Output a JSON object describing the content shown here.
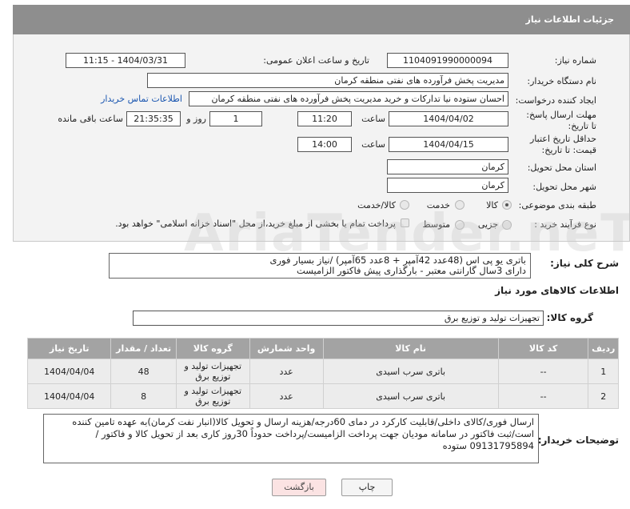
{
  "header": {
    "title": "جزئیات اطلاعات نیاز"
  },
  "fields": {
    "need_number_label": "شماره نیاز:",
    "need_number": "1104091990000094",
    "announce_label": "تاریخ و ساعت اعلان عمومی:",
    "announce_value": "1404/03/31 - 11:15",
    "buyer_org_label": "نام دستگاه خریدار:",
    "buyer_org": "مدیریت پخش فرآورده های نفتی منطقه کرمان",
    "requester_label": "ایجاد کننده درخواست:",
    "requester": "احسان  ستوده نیا  تدارکات و خرید  مدیریت پخش فرآورده های نفتی منطقه کرمان",
    "contact_link": "اطلاعات تماس خریدار",
    "deadline_label": "مهلت ارسال پاسخ: تا تاریخ:",
    "deadline_date": "1404/04/02",
    "time_label": "ساعت",
    "deadline_time": "11:20",
    "days_value": "1",
    "days_label": "روز و",
    "remaining_time": "21:35:35",
    "remaining_label": "ساعت باقی مانده",
    "price_validity_label": "حداقل تاریخ اعتبار قیمت: تا تاریخ:",
    "price_validity_date": "1404/04/15",
    "price_validity_time": "14:00",
    "province_label": "استان محل تحویل:",
    "province": "کرمان",
    "city_label": "شهر محل تحویل:",
    "city": "کرمان",
    "category_label": "طبقه بندی موضوعی:",
    "category_options": [
      "کالا",
      "خدمت",
      "کالا/خدمت"
    ],
    "purchase_type_label": "نوع فرآیند خرید :",
    "purchase_options": [
      "جزیی",
      "متوسط"
    ],
    "payment_note": "پرداخت تمام یا بخشی از مبلغ خرید،از محل \"اسناد خزانه اسلامی\" خواهد بود."
  },
  "description": {
    "label": "شرح کلی نیاز:",
    "text": "باتری یو پی اس (48عدد 42آمپر + 8عدد 65آمپر) /نیاز بسیار فوری\nدارای 3سال گارانتی معتبر - بارگذاری پیش فاکتور الزامیست"
  },
  "goods_section": {
    "title": "اطلاعات کالاهای مورد نیاز",
    "group_label": "گروه کالا:",
    "group_value": "تجهیزات تولید و توزیع برق",
    "columns": [
      "ردیف",
      "کد کالا",
      "نام کالا",
      "واحد شمارش",
      "گروه کالا",
      "تعداد / مقدار",
      "تاریخ نیاز"
    ],
    "rows": [
      {
        "row": "1",
        "code": "--",
        "name": "باتری سرب اسیدی",
        "unit": "عدد",
        "group": "تجهیزات تولید و توزیع برق",
        "qty": "48",
        "date": "1404/04/04"
      },
      {
        "row": "2",
        "code": "--",
        "name": "باتری سرب اسیدی",
        "unit": "عدد",
        "group": "تجهیزات تولید و توزیع برق",
        "qty": "8",
        "date": "1404/04/04"
      }
    ]
  },
  "buyer_notes": {
    "label": "توضیحات خریدار:",
    "text": "ارسال فوری/کالای داخلی/قابلیت کارکرد در دمای 60درجه/هزینه ارسال و تحویل کالا(انبار نفت کرمان)به عهده تامین کننده است/ثبت فاکتور در سامانه مودیان جهت پرداخت الزامیست/پرداخت حدوداً 30روز کاری بعد از تحویل کالا و فاکتور / 09131795894 ستوده"
  },
  "buttons": {
    "print": "چاپ",
    "back": "بازگشت"
  },
  "watermark": "AriaTender.neT"
}
